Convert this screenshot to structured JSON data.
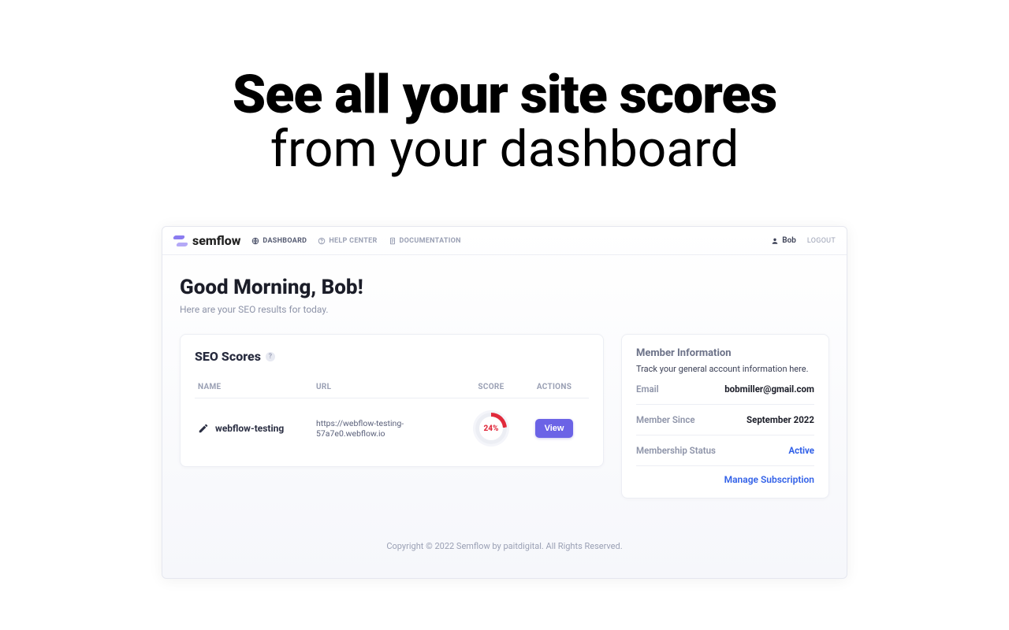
{
  "hero": {
    "line1": "See all your site scores",
    "line2": "from your dashboard"
  },
  "brand": "semflow",
  "nav": {
    "dashboard": "DASHBOARD",
    "help": "HELP CENTER",
    "docs": "DOCUMENTATION"
  },
  "user": {
    "name": "Bob",
    "logout": "LOGOUT"
  },
  "greeting": {
    "title": "Good Morning, Bob!",
    "sub": "Here are your SEO results for today."
  },
  "scores": {
    "title": "SEO Scores",
    "columns": {
      "name": "NAME",
      "url": "URL",
      "score": "SCORE",
      "actions": "ACTIONS"
    },
    "row": {
      "name": "webflow-testing",
      "url": "https://webflow-testing-57a7e0.webflow.io",
      "score": "24%",
      "view": "View"
    }
  },
  "member": {
    "title": "Member Information",
    "sub": "Track your general account information here.",
    "email_label": "Email",
    "email_value": "bobmiller@gmail.com",
    "since_label": "Member Since",
    "since_value": "September 2022",
    "status_label": "Membership Status",
    "status_value": "Active",
    "manage": "Manage Subscription"
  },
  "footer": "Copyright © 2022 Semflow by paitdigital. All Rights Reserved."
}
